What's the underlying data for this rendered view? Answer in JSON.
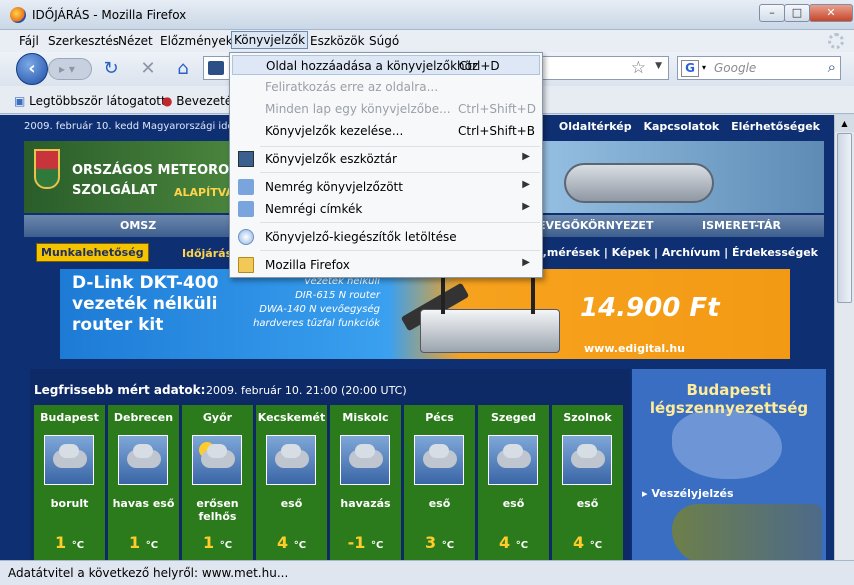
{
  "window": {
    "title": "IDŐJÁRÁS - Mozilla Firefox",
    "min": "–",
    "max": "□",
    "close": "✕"
  },
  "menu": [
    "Fájl",
    "Szerkesztés",
    "Nézet",
    "Előzmények",
    "Könyvjelzők",
    "Eszközök",
    "Súgó"
  ],
  "search": {
    "placeholder": "Google",
    "engine": "G"
  },
  "bookmarks": {
    "item1": "Legtöbbször látogatott",
    "item2": "Bevezeté"
  },
  "dropdown": [
    {
      "label": "Oldal hozzáadása a könyvjelzőkhöz",
      "shortcut": "Ctrl+D"
    },
    {
      "label": "Feliratkozás erre az oldalra...",
      "shortcut": ""
    },
    {
      "label": "Minden lap egy könyvjelzőbe...",
      "shortcut": "Ctrl+Shift+D"
    },
    {
      "label": "Könyvjelzők kezelése...",
      "shortcut": "Ctrl+Shift+B"
    },
    {
      "label": "Könyvjelzők eszköztár",
      "shortcut": ""
    },
    {
      "label": "Nemrég könyvjelzőzött",
      "shortcut": ""
    },
    {
      "label": "Nemrégi címkék",
      "shortcut": ""
    },
    {
      "label": "Könyvjelző-kiegészítők letöltése",
      "shortcut": ""
    },
    {
      "label": "Mozilla Firefox",
      "shortcut": ""
    }
  ],
  "page": {
    "date": "2009. február 10. kedd   Magyarországi idő:",
    "toplinks": [
      "Oldaltérkép",
      "Kapcsolatok",
      "Elérhetőségek"
    ],
    "org1": "ORSZÁGOS METEOROLÓGIA",
    "org2": "SZOLGÁLAT",
    "founded": "ALAPÍTVA: 187",
    "tabs": [
      "OMSZ",
      "EVEGŐKÖRNYEZET",
      "ISMERET-TÁR"
    ],
    "munka": "Munkalehetőség",
    "idojaras": "Időjárás",
    "sublinks": [
      "k,mérések",
      "Képek",
      "Archívum",
      "Érdekességek"
    ],
    "ad": {
      "headline1": "D-Link DKT-400",
      "headline2": "vezeték nélküli",
      "headline3": "router kit",
      "l1": "vezeték nélküli",
      "l2": "DIR-615 N router",
      "l3": "DWA-140 N vevőegység",
      "l4": "hardveres tűzfal funkciók",
      "price": "14.900 Ft",
      "url": "www.edigital.hu"
    },
    "weather_title": "Legfrissebb mért adatok:",
    "weather_time": "2009. február 10. 21:00 (20:00 UTC)",
    "unit": "°C",
    "cities": [
      {
        "name": "Budapest",
        "desc": "borult",
        "temp": "1"
      },
      {
        "name": "Debrecen",
        "desc": "havas eső",
        "temp": "1"
      },
      {
        "name": "Győr",
        "desc": "erősen felhős",
        "temp": "1"
      },
      {
        "name": "Kecskemét",
        "desc": "eső",
        "temp": "4"
      },
      {
        "name": "Miskolc",
        "desc": "havazás",
        "temp": "-1"
      },
      {
        "name": "Pécs",
        "desc": "eső",
        "temp": "3"
      },
      {
        "name": "Szeged",
        "desc": "eső",
        "temp": "4"
      },
      {
        "name": "Szolnok",
        "desc": "eső",
        "temp": "4"
      }
    ],
    "side_title1": "Budapesti",
    "side_title2": "légszennyezettség",
    "side_warn": "Veszélyjelzés"
  },
  "status": "Adatátvitel a következő helyről: www.met.hu..."
}
